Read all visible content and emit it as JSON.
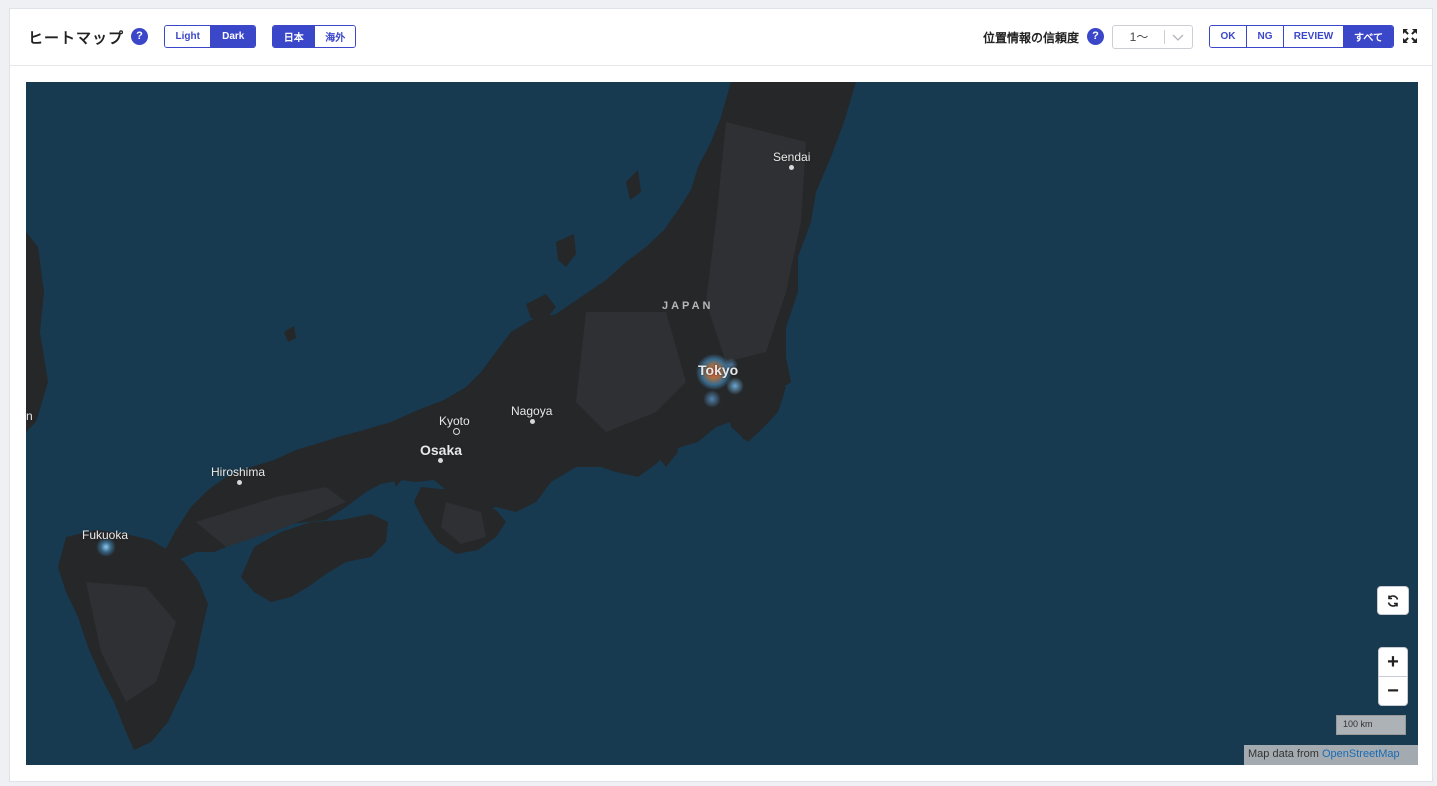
{
  "header": {
    "title": "ヒートマップ",
    "help": "?",
    "theme": {
      "options": [
        "Light",
        "Dark"
      ],
      "selected": "Dark"
    },
    "region": {
      "options": [
        "日本",
        "海外"
      ],
      "selected": "日本"
    },
    "confidence_label": "位置情報の信頼度",
    "confidence_select": {
      "value": "1〜"
    },
    "status_filter": {
      "options": [
        "OK",
        "NG",
        "REVIEW",
        "すべて"
      ],
      "selected": "すべて"
    }
  },
  "map": {
    "country_label": "JAPAN",
    "cities": [
      "Sendai",
      "Tokyo",
      "Nagoya",
      "Kyoto",
      "Osaka",
      "Hiroshima",
      "Fukuoka"
    ],
    "edge_label": "n",
    "controls": {
      "zoom_in": "+",
      "zoom_out": "−"
    },
    "scale_label": "100 km",
    "attribution_prefix": "Map data from ",
    "attribution_link": "OpenStreetMap"
  },
  "colors": {
    "accent": "#3b47c9",
    "sea": "#173a50",
    "land": "#252729",
    "highland": "#2e3033",
    "heat_low": "#4aa3df",
    "heat_high": "#ff5a2a"
  }
}
